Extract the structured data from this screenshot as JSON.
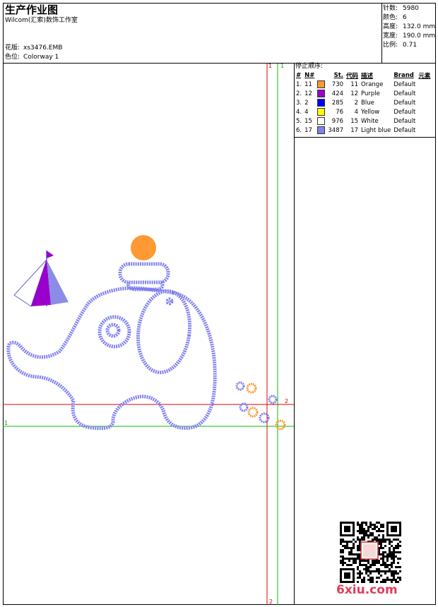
{
  "header": {
    "title": "生产作业图",
    "company": "Wilcom(汇索)数饰工作室",
    "design_label": "花版:",
    "design_value": "xs3476.EMB",
    "colorway_label": "色位:",
    "colorway_value": "Colorway 1"
  },
  "stats": [
    {
      "label": "针数:",
      "value": "5980"
    },
    {
      "label": "颜色:",
      "value": "6"
    },
    {
      "label": "高度:",
      "value": "132.0 mm"
    },
    {
      "label": "宽度:",
      "value": "190.0 mm"
    },
    {
      "label": "比例:",
      "value": "0.71"
    }
  ],
  "stop_sequence": {
    "heading": "停止顺序:",
    "columns": [
      "#",
      "N#",
      "St.",
      "代码",
      "描述",
      "Brand",
      "元素"
    ],
    "rows": [
      {
        "idx": "1.",
        "n": "11",
        "color": "#ff9933",
        "st": "730",
        "code": "11",
        "desc": "Orange",
        "brand": "Default"
      },
      {
        "idx": "2.",
        "n": "12",
        "color": "#9900cc",
        "st": "424",
        "code": "12",
        "desc": "Purple",
        "brand": "Default"
      },
      {
        "idx": "3.",
        "n": "2",
        "color": "#0000ff",
        "st": "285",
        "code": "2",
        "desc": "Blue",
        "brand": "Default"
      },
      {
        "idx": "4.",
        "n": "4",
        "color": "#ffff00",
        "st": "76",
        "code": "4",
        "desc": "Yellow",
        "brand": "Default"
      },
      {
        "idx": "5.",
        "n": "15",
        "color": "#ffffff",
        "st": "976",
        "code": "15",
        "desc": "White",
        "brand": "Default"
      },
      {
        "idx": "6.",
        "n": "17",
        "color": "#8080f0",
        "st": "3487",
        "code": "17",
        "desc": "Light blue",
        "brand": "Default"
      }
    ]
  },
  "guides": {
    "red_v_top": "1",
    "red_v_bottom": "2",
    "green_v_top": "1",
    "red_h_right": "2",
    "green_h_left": "1"
  },
  "watermark": "6xiu.com"
}
